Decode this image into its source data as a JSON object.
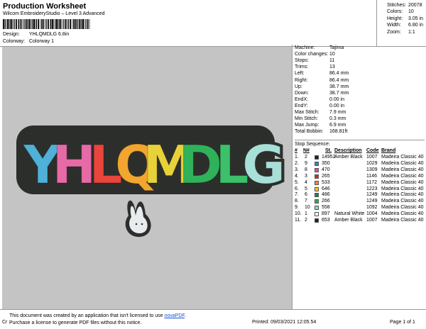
{
  "header": {
    "title": "Production Worksheet",
    "software": "Wilcom EmbroideryStudio – Level 3 Advanced",
    "design_label": "Design:",
    "design_value": "YHLQMDLG 6.8in",
    "colorway_label": "Colorway:",
    "colorway_value": "Colorway 1"
  },
  "stats": [
    {
      "label": "Stitches:",
      "value": "20078"
    },
    {
      "label": "Colors:",
      "value": "10"
    },
    {
      "label": "Height:",
      "value": "3.05 in"
    },
    {
      "label": "Width:",
      "value": "6.80 in"
    },
    {
      "label": "Zoom:",
      "value": "1:1"
    }
  ],
  "design_text": "YHLQMDLG",
  "design_colors": {
    "background": "#c4c4c4",
    "outline": "#2d2f2c",
    "letters": [
      "#4fb0d8",
      "#e66aa6",
      "#e8453c",
      "#f2a62f",
      "#e8d23a",
      "#2fb25a",
      "#3cc06a",
      "#a8e0d8"
    ],
    "bunny": "#e9ecef"
  },
  "machine": [
    {
      "label": "Machine:",
      "value": "Tajima"
    },
    {
      "label": "Color changes:",
      "value": "10"
    },
    {
      "label": "Stops:",
      "value": "11"
    },
    {
      "label": "Trims:",
      "value": "13"
    },
    {
      "label": "Left:",
      "value": "86.4 mm"
    },
    {
      "label": "Right:",
      "value": "86.4 mm"
    },
    {
      "label": "Up:",
      "value": "38.7 mm"
    },
    {
      "label": "Down:",
      "value": "38.7 mm"
    },
    {
      "label": "EndX:",
      "value": "0.00 in"
    },
    {
      "label": "EndY:",
      "value": "0.00 in"
    },
    {
      "label": "Max Stitch:",
      "value": "7.9 mm"
    },
    {
      "label": "Min Stitch:",
      "value": "0.3 mm"
    },
    {
      "label": "Max Jump:",
      "value": "6.9 mm"
    },
    {
      "label": "Total Bobbin:",
      "value": "168.81ft"
    }
  ],
  "stop_sequence": {
    "title": "Stop Sequence:",
    "headers": {
      "stop": "#",
      "needle": "N#",
      "st": "St.",
      "description": "Description",
      "code": "Code",
      "brand": "Brand"
    },
    "rows": [
      {
        "stop": "1.",
        "needle": "2",
        "color": "#222222",
        "st": "14952",
        "description": "Amber Black",
        "code": "1007",
        "brand": "Madeira Classic 40"
      },
      {
        "stop": "2.",
        "needle": "9",
        "color": "#1e8fc8",
        "st": "350",
        "description": "",
        "code": "1029",
        "brand": "Madeira Classic 40"
      },
      {
        "stop": "3.",
        "needle": "8",
        "color": "#e0519b",
        "st": "470",
        "description": "",
        "code": "1309",
        "brand": "Madeira Classic 40"
      },
      {
        "stop": "4.",
        "needle": "3",
        "color": "#d62a2a",
        "st": "265",
        "description": "",
        "code": "1146",
        "brand": "Madeira Classic 40"
      },
      {
        "stop": "5.",
        "needle": "4",
        "color": "#f18a1c",
        "st": "533",
        "description": "",
        "code": "1172",
        "brand": "Madeira Classic 40"
      },
      {
        "stop": "6.",
        "needle": "5",
        "color": "#f2c81e",
        "st": "646",
        "description": "",
        "code": "1223",
        "brand": "Madeira Classic 40"
      },
      {
        "stop": "7.",
        "needle": "6",
        "color": "#1b8a3a",
        "st": "486",
        "description": "",
        "code": "1249",
        "brand": "Madeira Classic 40"
      },
      {
        "stop": "8.",
        "needle": "7",
        "color": "#2bb24a",
        "st": "266",
        "description": "",
        "code": "1249",
        "brand": "Madeira Classic 40"
      },
      {
        "stop": "9.",
        "needle": "10",
        "color": "#8fd3d6",
        "st": "558",
        "description": "",
        "code": "1092",
        "brand": "Madeira Classic 40"
      },
      {
        "stop": "10.",
        "needle": "1",
        "color": "#ffffff",
        "st": "897",
        "description": "Natural White",
        "code": "1004",
        "brand": "Madeira Classic 40"
      },
      {
        "stop": "11.",
        "needle": "2",
        "color": "#222222",
        "st": "653",
        "description": "Amber Black",
        "code": "1007",
        "brand": "Madeira Classic 40"
      }
    ]
  },
  "footer": {
    "notice_line1": "This document was created by an application that isn't licensed to use ",
    "notice_link": "novaPDF",
    "notice_line1_end": ".",
    "notice_line2": "Purchase a license to generate PDF files without this notice.",
    "cr_text": "Cr",
    "printed": "Printed: 09/03/2021 12:05.54",
    "page": "Page 1 of 1"
  }
}
